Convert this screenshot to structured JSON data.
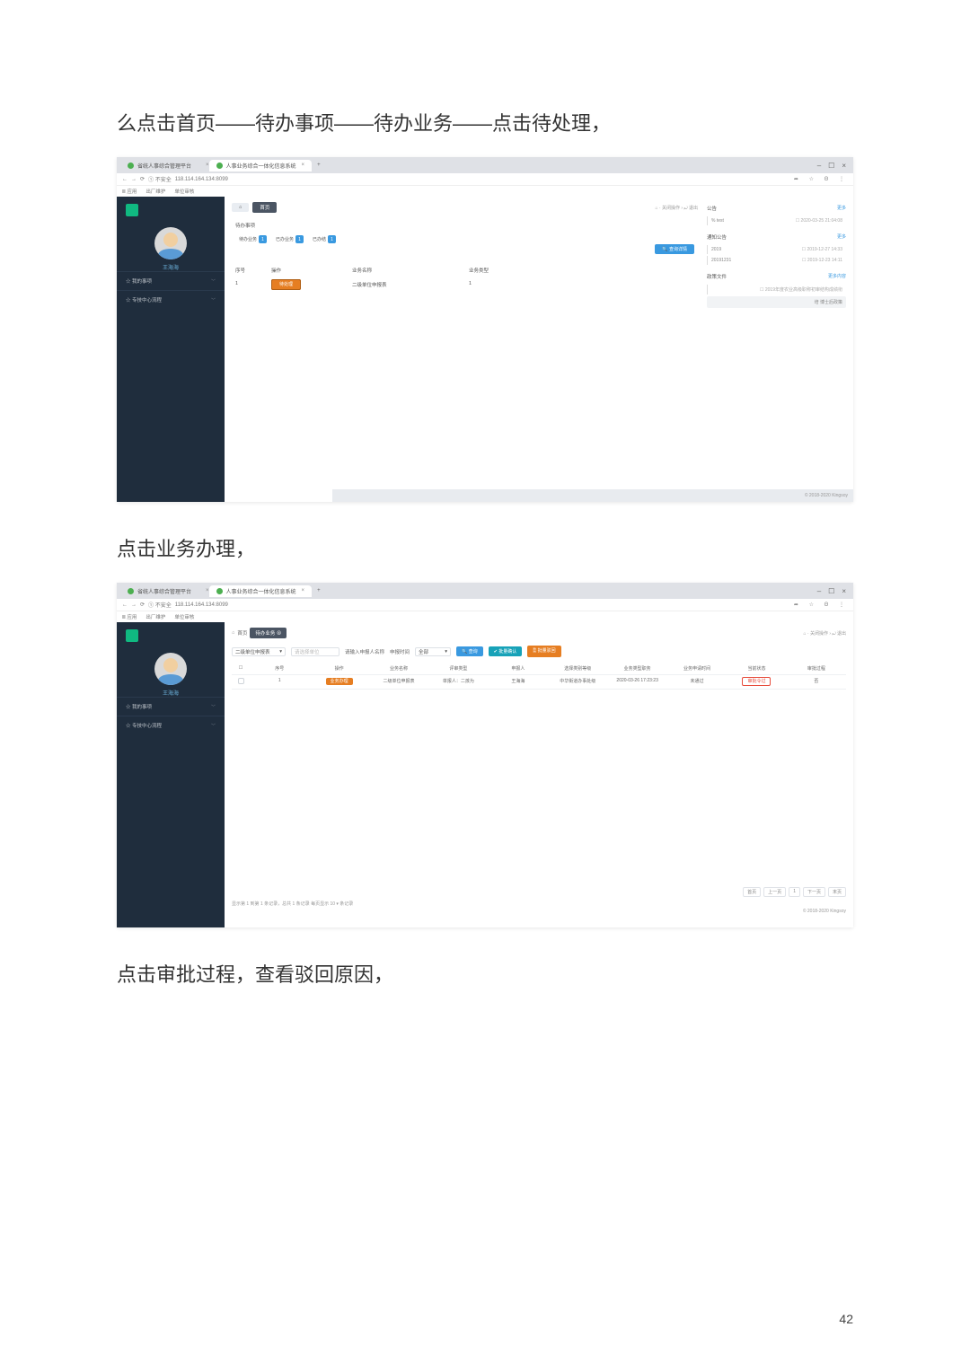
{
  "instructions": {
    "line1": "么点击首页——待办事项——待办业务——点击待处理，",
    "line2": "点击业务办理，",
    "line3": "点击审批过程，查看驳回原因，"
  },
  "page_number": "42",
  "browser": {
    "tab1": "省统人事综合管理平台",
    "tab2": "人事业务综合一体化信息系统",
    "close_x": "×",
    "plus": "+",
    "win_min": "–",
    "win_max": "☐",
    "win_close": "×",
    "nav_back": "←",
    "nav_fwd": "→",
    "reload": "⟳",
    "secure": "① 不安全",
    "url": "118.114.164.134:8099",
    "addr_right_1": "➦",
    "addr_right_2": "☆",
    "addr_right_3": "Θ",
    "addr_right_4": "⋮",
    "bm_apps": "Ⅲ 应用",
    "bm1": "出厂维护",
    "bm2": "单位审核"
  },
  "sidebar": {
    "username": "王海海",
    "nav1": "☆ 我的事项",
    "nav2": "☆ 专技中心流程"
  },
  "screen1": {
    "tab_home": "⌂",
    "tab_main": "首页",
    "right_meta": "⌂ · 关闭操作 ›   ⤾ 退出",
    "section": "待办事项",
    "filter1": "待办业务",
    "filter1_badge": "1",
    "filter2": "已办业务",
    "filter2_badge": "1",
    "filter3": "已办结",
    "filter3_badge": "1",
    "query_btn": "🔍 查询详情",
    "th1": "序号",
    "th2": "操作",
    "th3": "业务名称",
    "th4": "业务类型",
    "row_idx": "1",
    "row_op": "待处理",
    "row_biz": "二级单位申报表",
    "row_type": "1",
    "rp1_head": "公告",
    "rp1_more": "更多",
    "rp1_item1_l": "% test",
    "rp1_item1_r": "☐ 2020-03-25 21:04:08",
    "rp2_head": "通知公告",
    "rp2_more": "更多",
    "rp2_item1_l": "2019",
    "rp2_item1_r": "☐ 2019-12-27 14:33",
    "rp2_item2_l": "20191231",
    "rp2_item2_r": "☐ 2019-12-23 14:11",
    "rp3_head": "政策文件",
    "rp3_more": "更多内容",
    "rp3_item1_r": "☐ 2019年度农业高级职称初审结构成绩衔",
    "rp3_card": "培 博士后政策",
    "footer": "© 2018-2020 Kingsoy"
  },
  "screen2": {
    "crumb_home": "⌂",
    "crumb1": "首页",
    "crumb2": "待办业务 ⊗",
    "right_meta": "⌂ · 关闭操作 ›   ⤾ 退出",
    "f_label1": "二级单位申报表",
    "f_label1_caret": "▾",
    "f_label2": "请选择单位",
    "f_label3": "请输入申报人名称",
    "f_label4": "申报时间",
    "f_label5": "全部",
    "f_label5_caret": "▾",
    "btn_search": "🔍 查询",
    "btn_confirm": "✔ 批量确认",
    "btn_export": "🖺 批量驳回",
    "h_check": "☐",
    "h_idx": "序号",
    "h_op": "操作",
    "h_bizname": "业务名称",
    "h_biztype": "评审类型",
    "h_org1": "申报人",
    "h_org2": "选择类别等级",
    "h_field": "业务类型职务",
    "h_time": "业务申请时间",
    "h_status": "当前状态",
    "h_proc": "审批过程",
    "d_check": "",
    "d_idx": "1",
    "d_op": "业务办理",
    "d_bizname": "二级单位申报表",
    "d_biztype": "单报人：二孩为",
    "d_org1": "王海海",
    "d_org2": "中华街道办事处级",
    "d_field": "2020-03-26 17:23:23",
    "d_time": "未通过",
    "d_status": "审批令过",
    "d_proc": "否",
    "result_info": "显示第 1 到第 1 条记录，总共 1 条记录 每页显示  10 ▾  条记录",
    "pg_first": "首页",
    "pg_prev": "上一页",
    "pg_1": "1",
    "pg_next": "下一页",
    "pg_last": "末页",
    "footer": "© 2018-2020 Kingsoy"
  }
}
